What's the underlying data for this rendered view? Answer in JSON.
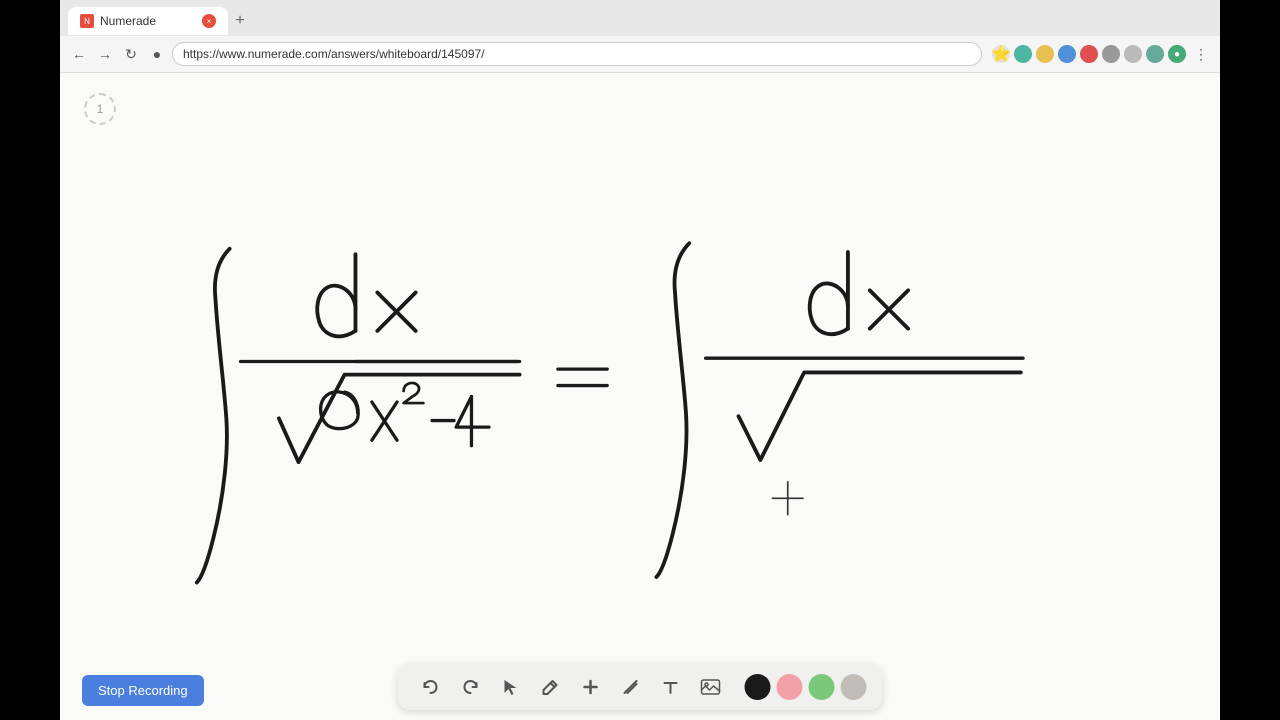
{
  "browser": {
    "tab_title": "Numerade",
    "url": "https://www.numerade.com/answers/whiteboard/145097/",
    "tab_close_label": "×",
    "tab_new_label": "+"
  },
  "page": {
    "number": "1"
  },
  "toolbar": {
    "undo_label": "↺",
    "redo_label": "↻",
    "stop_recording_label": "Stop Recording",
    "tools": [
      {
        "name": "undo",
        "icon": "↺"
      },
      {
        "name": "redo",
        "icon": "↻"
      },
      {
        "name": "select",
        "icon": "▷"
      },
      {
        "name": "pen",
        "icon": "✏"
      },
      {
        "name": "add",
        "icon": "+"
      },
      {
        "name": "highlight",
        "icon": "/"
      },
      {
        "name": "text",
        "icon": "T"
      },
      {
        "name": "image",
        "icon": "🖼"
      }
    ],
    "colors": [
      {
        "name": "black",
        "value": "#1a1a1a"
      },
      {
        "name": "pink",
        "value": "#f4a0a8"
      },
      {
        "name": "green",
        "value": "#7bc87a"
      },
      {
        "name": "gray",
        "value": "#c0bdb8"
      }
    ]
  },
  "math": {
    "equation_left": "∫ dx / √(9x²−4)",
    "equation_right": "∫ dx / √(...)"
  }
}
